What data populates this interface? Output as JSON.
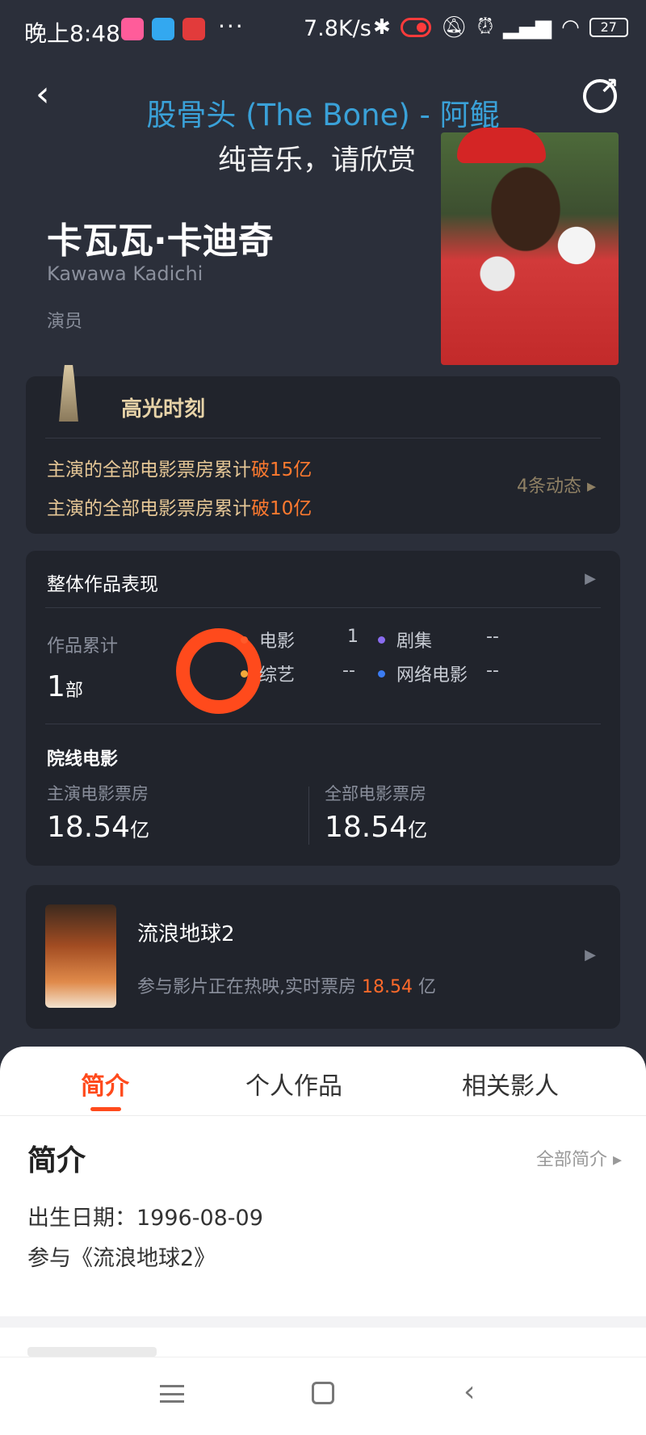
{
  "status_bar": {
    "time": "晚上8:48",
    "more": "···",
    "speed": "7.8K/s",
    "battery": "27"
  },
  "header": {
    "song_title": "股骨头 (The Bone) - 阿鲲",
    "lyric": "纯音乐，请欣赏"
  },
  "person": {
    "name_cn": "卡瓦瓦·卡迪奇",
    "name_en": "Kawawa Kadichi",
    "role": "演员"
  },
  "highlight": {
    "title": "高光时刻",
    "line1_prefix": "主演的全部电影票房累计",
    "line1_hot": "破15亿",
    "line2_prefix": "主演的全部电影票房累计",
    "line2_hot": "破10亿",
    "more": "4条动态 ▸"
  },
  "overall": {
    "title": "整体作品表现",
    "works_label": "作品累计",
    "works_value": "1",
    "works_unit": "部",
    "legend": [
      {
        "label": "电影",
        "value": "1",
        "color": "#ff5a2a"
      },
      {
        "label": "剧集",
        "value": "--",
        "color": "#8a6cf0"
      },
      {
        "label": "综艺",
        "value": "--",
        "color": "#f2a93b"
      },
      {
        "label": "网络电影",
        "value": "--",
        "color": "#3b7cf2"
      }
    ],
    "cinema_title": "院线电影",
    "lead_bo_label": "主演电影票房",
    "lead_bo_value": "18.54",
    "lead_bo_unit": "亿",
    "all_bo_label": "全部电影票房",
    "all_bo_value": "18.54",
    "all_bo_unit": "亿"
  },
  "movie": {
    "title": "流浪地球2",
    "sub_prefix": "参与影片正在热映,实时票房",
    "sub_value": "18.54",
    "sub_unit": "亿"
  },
  "tabs": [
    "简介",
    "个人作品",
    "相关影人"
  ],
  "intro": {
    "heading": "简介",
    "all": "全部简介 ▸",
    "birth": "出生日期：1996-08-09",
    "participated": "参与《流浪地球2》"
  }
}
